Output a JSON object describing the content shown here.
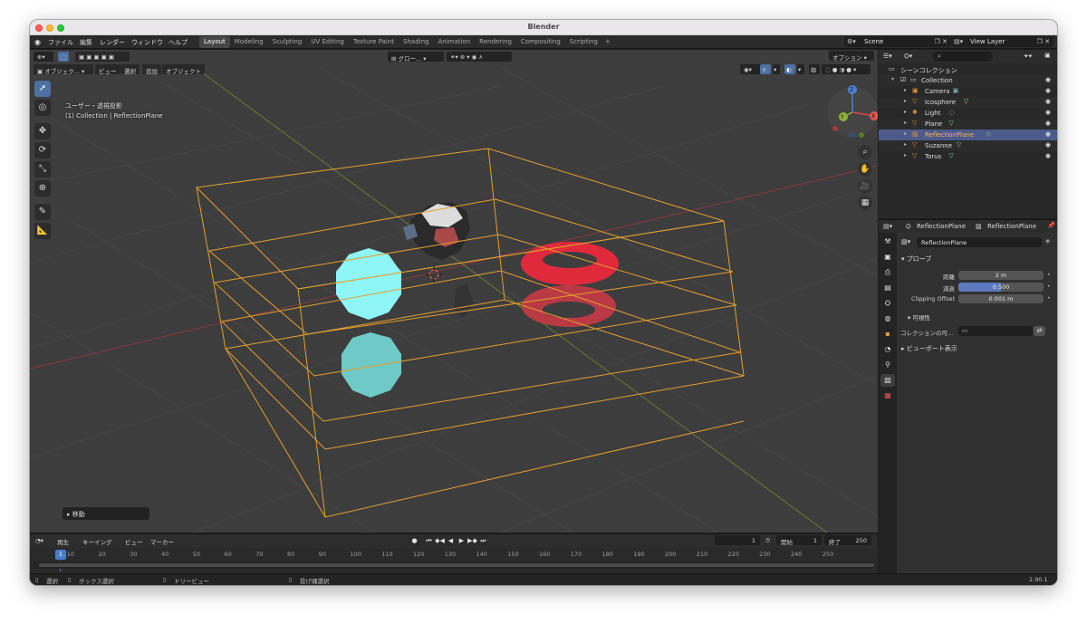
{
  "window": {
    "title": "Blender"
  },
  "menubar": {
    "menus": [
      "ファイル",
      "編集",
      "レンダー",
      "ウィンドウ",
      "ヘルプ"
    ],
    "workspaces": [
      "Layout",
      "Modeling",
      "Sculpting",
      "UV Editing",
      "Texture Paint",
      "Shading",
      "Animation",
      "Rendering",
      "Compositing",
      "Scripting"
    ],
    "active_workspace": "Layout",
    "add_tab": "+",
    "scene": "Scene",
    "view_layer": "View Layer"
  },
  "viewport": {
    "header": {
      "mode": "オブジェク...",
      "menus": [
        "ビュー",
        "選択",
        "追加",
        "オブジェクト"
      ],
      "transform_orientation": "グロー...",
      "options": "オプション"
    },
    "overlay_text": {
      "view_name": "ユーザー・透視投影",
      "context": "(1) Collection | ReflectionPlane"
    },
    "last_operator": "▸ 移動",
    "gizmo_axes": {
      "x": "X",
      "y": "Y",
      "z": "Z"
    }
  },
  "timeline": {
    "menus": [
      "再生",
      "キーイング",
      "ビュー",
      "マーカー"
    ],
    "current_frame": "1",
    "start_label": "開始",
    "start": "1",
    "end_label": "終了",
    "end": "250",
    "ruler_ticks": [
      "10",
      "20",
      "30",
      "40",
      "50",
      "60",
      "70",
      "80",
      "90",
      "100",
      "110",
      "120",
      "130",
      "140",
      "150",
      "160",
      "170",
      "180",
      "190",
      "200",
      "210",
      "220",
      "230",
      "240",
      "250"
    ],
    "playhead": "1"
  },
  "statusbar": {
    "items": [
      "選択",
      "ボックス選択",
      "ドリービュー",
      "投げ縄選択"
    ],
    "version": "2.90.1"
  },
  "outliner": {
    "search_placeholder": "",
    "root": "シーンコレクション",
    "collection": "Collection",
    "items": [
      {
        "label": "Camera",
        "icon": "camera-icon",
        "color": "#e0913a"
      },
      {
        "label": "Icosphere",
        "icon": "mesh-icon",
        "color": "#e0913a"
      },
      {
        "label": "Light",
        "icon": "light-icon",
        "color": "#e0913a"
      },
      {
        "label": "Plane",
        "icon": "mesh-icon",
        "color": "#e0913a"
      },
      {
        "label": "ReflectionPlane",
        "icon": "lightprobe-icon",
        "color": "#e0913a",
        "selected": true
      },
      {
        "label": "Suzanne",
        "icon": "mesh-icon",
        "color": "#e0913a"
      },
      {
        "label": "Torus",
        "icon": "mesh-icon",
        "color": "#e0913a"
      }
    ]
  },
  "properties": {
    "breadcrumb_object": "ReflectionPlane",
    "breadcrumb_data": "ReflectionPlane",
    "datablock_name": "ReflectionPlane",
    "probe_panel": "プローブ",
    "fields": [
      {
        "label": "距離",
        "value": "2 m"
      },
      {
        "label": "減衰",
        "value": "0.500",
        "fraction": 0.5
      },
      {
        "label": "Clipping Offset",
        "value": "0.001 m"
      }
    ],
    "visibility_panel": "可視性",
    "collection_label": "コレクションの可...",
    "viewport_display_panel": "ビューポート表示"
  },
  "colors": {
    "accent": "#4d6fa1",
    "selection": "#4d5b8c",
    "wireframe": "#e39f2f",
    "sphere": "#8ff5f7",
    "torus": "#e02a3c"
  }
}
